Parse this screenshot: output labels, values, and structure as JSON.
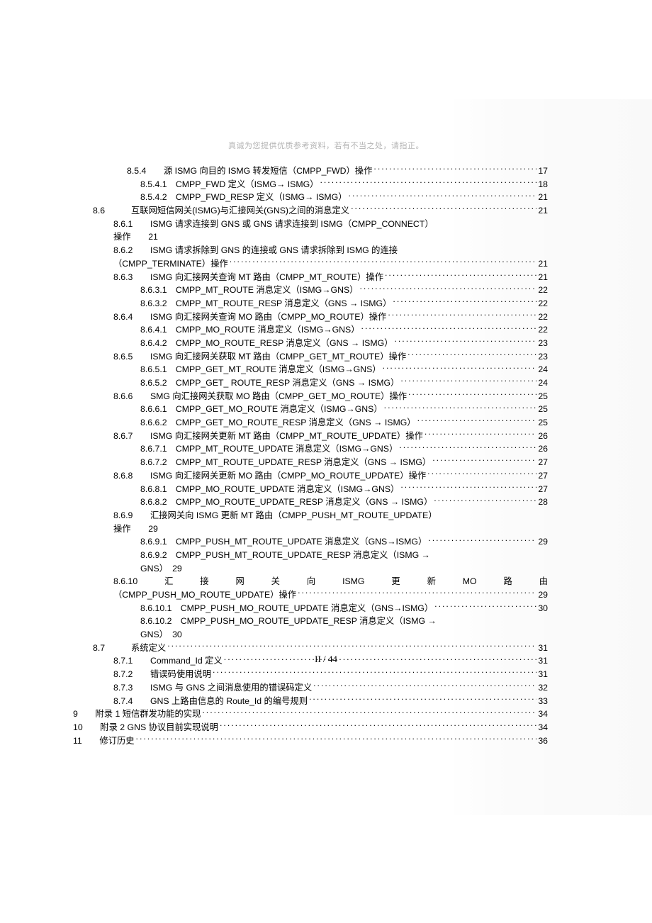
{
  "header": "真诚为您提供优质参考资料，若有不当之处，请指正。",
  "page_number": "II / 44",
  "toc": [
    {
      "i": "ind-a",
      "t": "8.5.4　　源 ISMG 向目的 ISMG 转发短信（CMPP_FWD）操作",
      "p": "17",
      "dots": true
    },
    {
      "i": "ind-c",
      "t": "8.5.4.1　CMPP_FWD 定义（ISMG→ ISMG）",
      "p": "18",
      "dots": true
    },
    {
      "i": "ind-c",
      "t": "8.5.4.2　CMPP_FWD_RESP 定义（ISMG→ ISMG）",
      "p": "21",
      "dots": true
    },
    {
      "i": "ind-top",
      "t": "8.6　　　互联网短信网关(ISMG)与汇接网关(GNS)之间的消息定义 ",
      "p": "21",
      "dots": true
    },
    {
      "i": "ind-b",
      "t": "8.6.1　　ISMG 请求连接到 GNS 或 GNS 请求连接到 ISMG（CMPP_CONNECT）",
      "p": "",
      "dots": false
    },
    {
      "i": "ind-b",
      "t": "操作　　21",
      "p": "",
      "dots": false
    },
    {
      "i": "ind-b",
      "t": "8.6.2　　ISMG 请求拆除到 GNS 的连接或 GNS 请求拆除到 ISMG 的连接",
      "p": "",
      "dots": false
    },
    {
      "i": "ind-b",
      "t": "（CMPP_TERMINATE）操作 ",
      "p": "21",
      "dots": true
    },
    {
      "i": "ind-b",
      "t": "8.6.3　　ISMG 向汇接网关查询 MT 路由（CMPP_MT_ROUTE）操作 ",
      "p": "21",
      "dots": true
    },
    {
      "i": "ind-c",
      "t": "8.6.3.1　CMPP_MT_ROUTE 消息定义（ISMG→GNS）",
      "p": "22",
      "dots": true
    },
    {
      "i": "ind-c",
      "t": "8.6.3.2　CMPP_MT_ROUTE_RESP 消息定义（GNS → ISMG）",
      "p": "22",
      "dots": true
    },
    {
      "i": "ind-b",
      "t": "8.6.4　　ISMG 向汇接网关查询 MO 路由（CMPP_MO_ROUTE）操作 ",
      "p": "22",
      "dots": true
    },
    {
      "i": "ind-c",
      "t": "8.6.4.1　CMPP_MO_ROUTE 消息定义（ISMG→GNS）",
      "p": "22",
      "dots": true
    },
    {
      "i": "ind-c",
      "t": "8.6.4.2　CMPP_MO_ROUTE_RESP 消息定义（GNS → ISMG）",
      "p": "23",
      "dots": true
    },
    {
      "i": "ind-b",
      "t": "8.6.5　　ISMG 向汇接网关获取 MT 路由（CMPP_GET_MT_ROUTE）操作",
      "p": "23",
      "dots": true
    },
    {
      "i": "ind-c",
      "t": "8.6.5.1　CMPP_GET_MT_ROUTE 消息定义（ISMG→GNS）",
      "p": "24",
      "dots": true
    },
    {
      "i": "ind-c",
      "t": "8.6.5.2　CMPP_GET_ ROUTE_RESP 消息定义（GNS → ISMG）",
      "p": "24",
      "dots": true
    },
    {
      "i": "ind-b",
      "t": "8.6.6　　SMG 向汇接网关获取 MO 路由（CMPP_GET_MO_ROUTE）操作",
      "p": "25",
      "dots": true
    },
    {
      "i": "ind-c",
      "t": "8.6.6.1　CMPP_GET_MO_ROUTE 消息定义（ISMG→GNS）",
      "p": "25",
      "dots": true
    },
    {
      "i": "ind-c",
      "t": "8.6.6.2　CMPP_GET_MO_ROUTE_RESP 消息定义（GNS → ISMG）",
      "p": "25",
      "dots": true
    },
    {
      "i": "ind-b",
      "t": "8.6.7　　ISMG 向汇接网关更新 MT 路由（CMPP_MT_ROUTE_UPDATE）操作",
      "p": "26",
      "dots": true
    },
    {
      "i": "ind-c",
      "t": "8.6.7.1　CMPP_MT_ROUTE_UPDATE 消息定义（ISMG→GNS）",
      "p": "26",
      "dots": true
    },
    {
      "i": "ind-c",
      "t": "8.6.7.2　CMPP_MT_ROUTE_UPDATE_RESP 消息定义（GNS → ISMG）",
      "p": "27",
      "dots": true
    },
    {
      "i": "ind-b",
      "t": "8.6.8　　ISMG 向汇接网关更新 MO 路由（CMPP_MO_ROUTE_UPDATE）操作",
      "p": "27",
      "dots": true
    },
    {
      "i": "ind-c",
      "t": "8.6.8.1　CMPP_MO_ROUTE_UPDATE 消息定义（ISMG→GNS）",
      "p": "27",
      "dots": true
    },
    {
      "i": "ind-c",
      "t": "8.6.8.2　CMPP_MO_ROUTE_UPDATE_RESP 消息定义（GNS → ISMG）",
      "p": "28",
      "dots": true
    },
    {
      "i": "ind-b",
      "t": "8.6.9　　汇接网关向 ISMG 更新 MT 路由（CMPP_PUSH_MT_ROUTE_UPDATE）",
      "p": "",
      "dots": false
    },
    {
      "i": "ind-b",
      "t": "操作　　29",
      "p": "",
      "dots": false
    },
    {
      "i": "ind-c",
      "t": "8.6.9.1　CMPP_PUSH_MT_ROUTE_UPDATE 消息定义（GNS→ISMG）",
      "p": "29",
      "dots": true
    },
    {
      "i": "ind-c",
      "t": "8.6.9.2　CMPP_PUSH_MT_ROUTE_UPDATE_RESP 消息定义（ISMG →",
      "p": "",
      "dots": false
    },
    {
      "i": "ind-c",
      "t": "GNS）　29",
      "p": "",
      "dots": false
    },
    {
      "i": "ind-b",
      "t": "8.6.10　汇　接　网　关　向　ISMG　更　新　MO　路　由",
      "p": "",
      "dots": false,
      "just": true
    },
    {
      "i": "ind-b",
      "t": "（CMPP_PUSH_MO_ROUTE_UPDATE）操作 ",
      "p": "29",
      "dots": true
    },
    {
      "i": "ind-c",
      "t": "8.6.10.1　CMPP_PUSH_MO_ROUTE_UPDATE 消息定义（GNS→ISMG）",
      "p": "30",
      "dots": true
    },
    {
      "i": "ind-c",
      "t": "8.6.10.2　CMPP_PUSH_MO_ROUTE_UPDATE_RESP 消息定义（ISMG →",
      "p": "",
      "dots": false
    },
    {
      "i": "ind-c",
      "t": "GNS）　30",
      "p": "",
      "dots": false
    },
    {
      "i": "ind-top",
      "t": "8.7　　　系统定义 ",
      "p": "31",
      "dots": true
    },
    {
      "i": "ind-b",
      "t": "8.7.1　　Command_Id 定义",
      "p": "31",
      "dots": true
    },
    {
      "i": "ind-b",
      "t": "8.7.2　　错误码使用说明 ",
      "p": "31",
      "dots": true
    },
    {
      "i": "ind-b",
      "t": "8.7.3　　ISMG 与 GNS 之间消息使用的错误码定义 ",
      "p": "32",
      "dots": true
    },
    {
      "i": "ind-b",
      "t": "8.7.4　　GNS 上路由信息的 Route_Id 的编号规则",
      "p": "33",
      "dots": true
    },
    {
      "i": "lvl9",
      "t": "9　　附录 1 短信群发功能的实现",
      "p": "34",
      "dots": true
    },
    {
      "i": "lvl9",
      "t": "10　　附录 2 GNS 协议目前实现说明 ",
      "p": "34",
      "dots": true
    },
    {
      "i": "lvl9",
      "t": "11　　修订历史 ",
      "p": "36",
      "dots": true
    }
  ]
}
